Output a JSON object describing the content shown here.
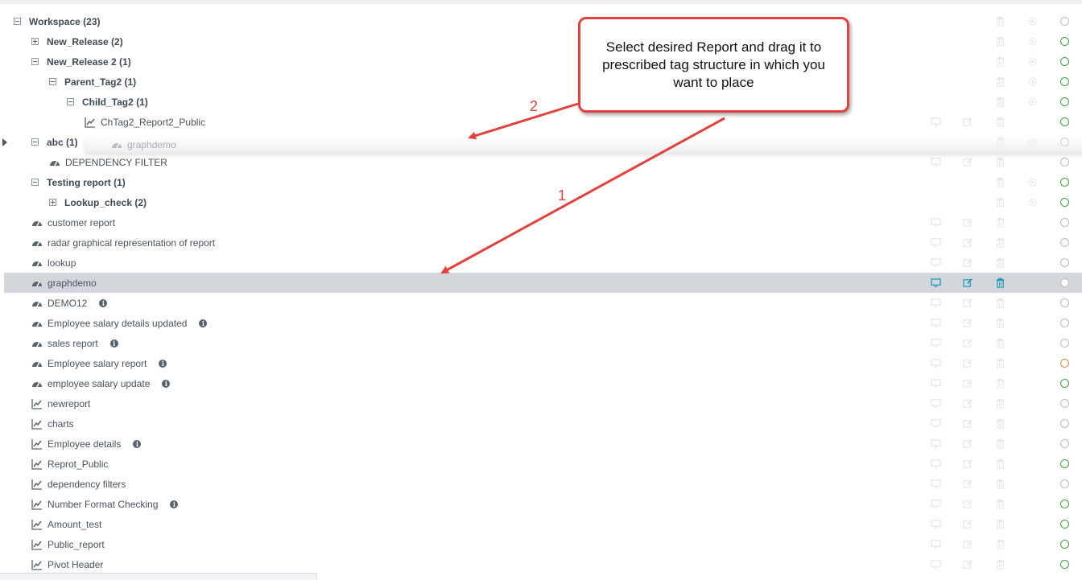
{
  "tree": {
    "rows": [
      {
        "kind": "tag",
        "label": "Workspace (23)",
        "level": 0,
        "toggle": "minus",
        "actions": "tag",
        "status": "gray"
      },
      {
        "kind": "tag",
        "label": "New_Release (2)",
        "level": 1,
        "toggle": "plus",
        "actions": "tag",
        "status": "green"
      },
      {
        "kind": "tag",
        "label": "New_Release 2 (1)",
        "level": 1,
        "toggle": "minus",
        "actions": "tag",
        "status": "green"
      },
      {
        "kind": "tag",
        "label": "Parent_Tag2 (1)",
        "level": 2,
        "toggle": "minus",
        "actions": "tag",
        "status": "green"
      },
      {
        "kind": "tag",
        "label": "Child_Tag2 (1)",
        "level": 3,
        "toggle": "minus",
        "actions": "tag",
        "status": "green"
      },
      {
        "kind": "report",
        "icon": "chart",
        "label": "ChTag2_Report2_Public",
        "level": 4,
        "actions": "report",
        "status": "green"
      },
      {
        "kind": "tag",
        "label": "abc (1)",
        "level": 1,
        "toggle": "minus",
        "actions": "tag",
        "status": "gray"
      },
      {
        "kind": "report",
        "icon": "dashboard",
        "label": "DEPENDENCY FILTER",
        "level": 2,
        "actions": "report",
        "status": "gray"
      },
      {
        "kind": "tag",
        "label": "Testing report (1)",
        "level": 1,
        "toggle": "minus",
        "actions": "tag",
        "status": "green"
      },
      {
        "kind": "tag",
        "label": "Lookup_check (2)",
        "level": 2,
        "toggle": "plus",
        "actions": "tag",
        "status": "green"
      },
      {
        "kind": "report",
        "icon": "dashboard",
        "label": "customer report",
        "level": 1,
        "actions": "report",
        "status": "gray"
      },
      {
        "kind": "report",
        "icon": "dashboard",
        "label": "radar graphical representation of report",
        "level": 1,
        "actions": "report",
        "status": "gray"
      },
      {
        "kind": "report",
        "icon": "dashboard",
        "label": "lookup",
        "level": 1,
        "actions": "report",
        "status": "gray"
      },
      {
        "kind": "report",
        "icon": "dashboard",
        "label": "graphdemo",
        "level": 1,
        "actions": "report",
        "status": "gray",
        "selected": true
      },
      {
        "kind": "report",
        "icon": "dashboard",
        "label": "DEMO12",
        "level": 1,
        "actions": "report",
        "status": "gray",
        "info": true
      },
      {
        "kind": "report",
        "icon": "dashboard",
        "label": "Employee salary details updated",
        "level": 1,
        "actions": "report",
        "status": "gray",
        "info": true
      },
      {
        "kind": "report",
        "icon": "dashboard",
        "label": "sales report",
        "level": 1,
        "actions": "report",
        "status": "gray",
        "info": true
      },
      {
        "kind": "report",
        "icon": "dashboard",
        "label": "Employee salary report",
        "level": 1,
        "actions": "report",
        "status": "orange",
        "info": true
      },
      {
        "kind": "report",
        "icon": "dashboard",
        "label": "employee salary update",
        "level": 1,
        "actions": "report",
        "status": "green",
        "info": true
      },
      {
        "kind": "report",
        "icon": "chart",
        "label": "newreport",
        "level": 1,
        "actions": "report",
        "status": "gray"
      },
      {
        "kind": "report",
        "icon": "chart",
        "label": "charts",
        "level": 1,
        "actions": "report",
        "status": "gray"
      },
      {
        "kind": "report",
        "icon": "chart",
        "label": "Employee details",
        "level": 1,
        "actions": "report",
        "status": "gray",
        "info": true
      },
      {
        "kind": "report",
        "icon": "chart",
        "label": "Reprot_Public",
        "level": 1,
        "actions": "report",
        "status": "green"
      },
      {
        "kind": "report",
        "icon": "chart",
        "label": "dependency filters",
        "level": 1,
        "actions": "report",
        "status": "gray"
      },
      {
        "kind": "report",
        "icon": "chart",
        "label": "Number Format Checking",
        "level": 1,
        "actions": "report",
        "status": "green",
        "info": true
      },
      {
        "kind": "report",
        "icon": "chart",
        "label": "Amount_test",
        "level": 1,
        "actions": "report",
        "status": "green"
      },
      {
        "kind": "report",
        "icon": "chart",
        "label": "Public_report",
        "level": 1,
        "actions": "report",
        "status": "green"
      },
      {
        "kind": "report",
        "icon": "chart",
        "label": "Pivot Header",
        "level": 1,
        "actions": "report",
        "status": "green"
      }
    ]
  },
  "drag_ghost": {
    "label": "graphdemo",
    "icon": "dashboard"
  },
  "callout": {
    "text": "Select desired Report and drag it to prescribed tag structure in which you want to place"
  },
  "steps": {
    "one": "1",
    "two": "2"
  },
  "colors": {
    "accent": "#1f9bb8",
    "status_green": "#3aa53a",
    "status_orange": "#e08a35",
    "status_gray": "#b6bcc2",
    "callout_red": "#e2413d",
    "selected_row": "#d3d6db"
  },
  "icons": {
    "preview": "monitor-icon",
    "edit": "edit-icon",
    "delete": "trash-icon",
    "settings": "gear-icon",
    "tag_settings": "gear-icon"
  }
}
